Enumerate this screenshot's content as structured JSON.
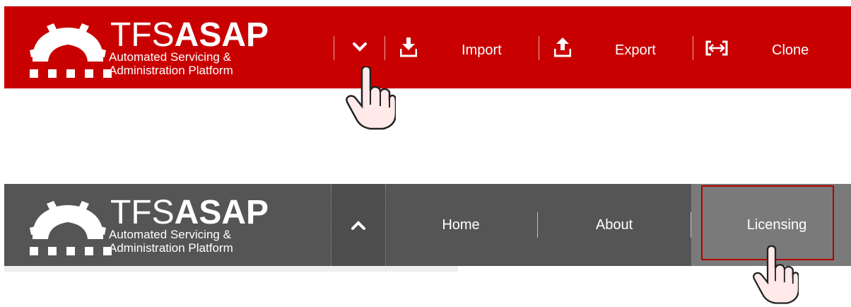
{
  "app": {
    "brand_prefix": "TFS",
    "brand_bold": "ASAP",
    "subtitle_line1": "Automated Servicing &",
    "subtitle_line2": "Administration Platform"
  },
  "toolbar_collapsed": {
    "background": "#c80000",
    "buttons": [
      {
        "label": "Import",
        "icon": "download-tray-icon"
      },
      {
        "label": "Export",
        "icon": "upload-tray-icon"
      },
      {
        "label": "Clone",
        "icon": "clone-arrows-icon"
      }
    ],
    "toggle_icon": "chevron-down-icon"
  },
  "nav_expanded": {
    "background": "#555555",
    "toggle_icon": "chevron-up-icon",
    "items": [
      {
        "label": "Home",
        "selected": false
      },
      {
        "label": "About",
        "selected": false
      },
      {
        "label": "Licensing",
        "selected": true
      }
    ],
    "highlight_color": "#b00000"
  }
}
